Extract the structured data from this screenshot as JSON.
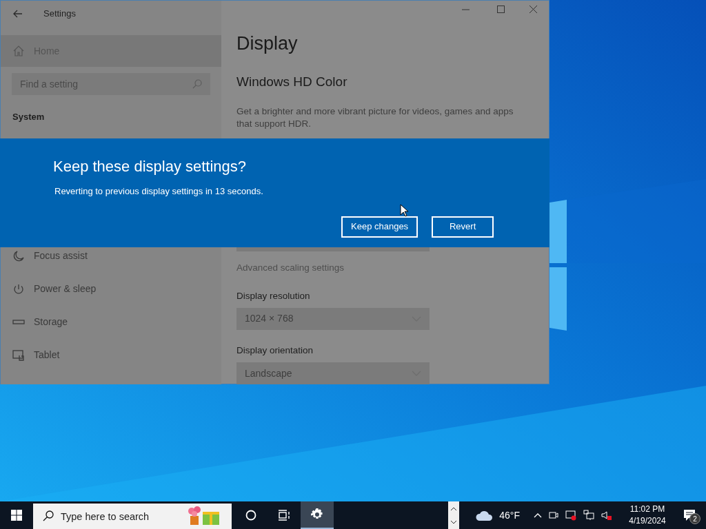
{
  "window": {
    "title": "Settings"
  },
  "sidebar": {
    "home": "Home",
    "search": {
      "placeholder": "Find a setting"
    },
    "section": "System",
    "items": [
      {
        "label": "Focus assist"
      },
      {
        "label": "Power & sleep"
      },
      {
        "label": "Storage"
      },
      {
        "label": "Tablet"
      }
    ]
  },
  "content": {
    "title": "Display",
    "heading": "Windows HD Color",
    "description": "Get a brighter and more vibrant picture for videos, games and apps that support HDR.",
    "link": "Advanced scaling settings",
    "fields": [
      {
        "label": "Display resolution",
        "value": "1024 × 768"
      },
      {
        "label": "Display orientation",
        "value": "Landscape"
      }
    ]
  },
  "dialog": {
    "title": "Keep these display settings?",
    "message": "Reverting to previous display settings in 13 seconds.",
    "buttons": [
      "Keep changes",
      "Revert"
    ]
  },
  "taskbar": {
    "search": {
      "placeholder": "Type here to search"
    },
    "apps": [
      {
        "kind": "cortana",
        "selected": false
      },
      {
        "kind": "taskview",
        "selected": false
      },
      {
        "kind": "settings",
        "selected": true
      }
    ],
    "weather": "46°F",
    "time": "11:02 PM",
    "date": "4/19/2024",
    "notifications": "2"
  }
}
